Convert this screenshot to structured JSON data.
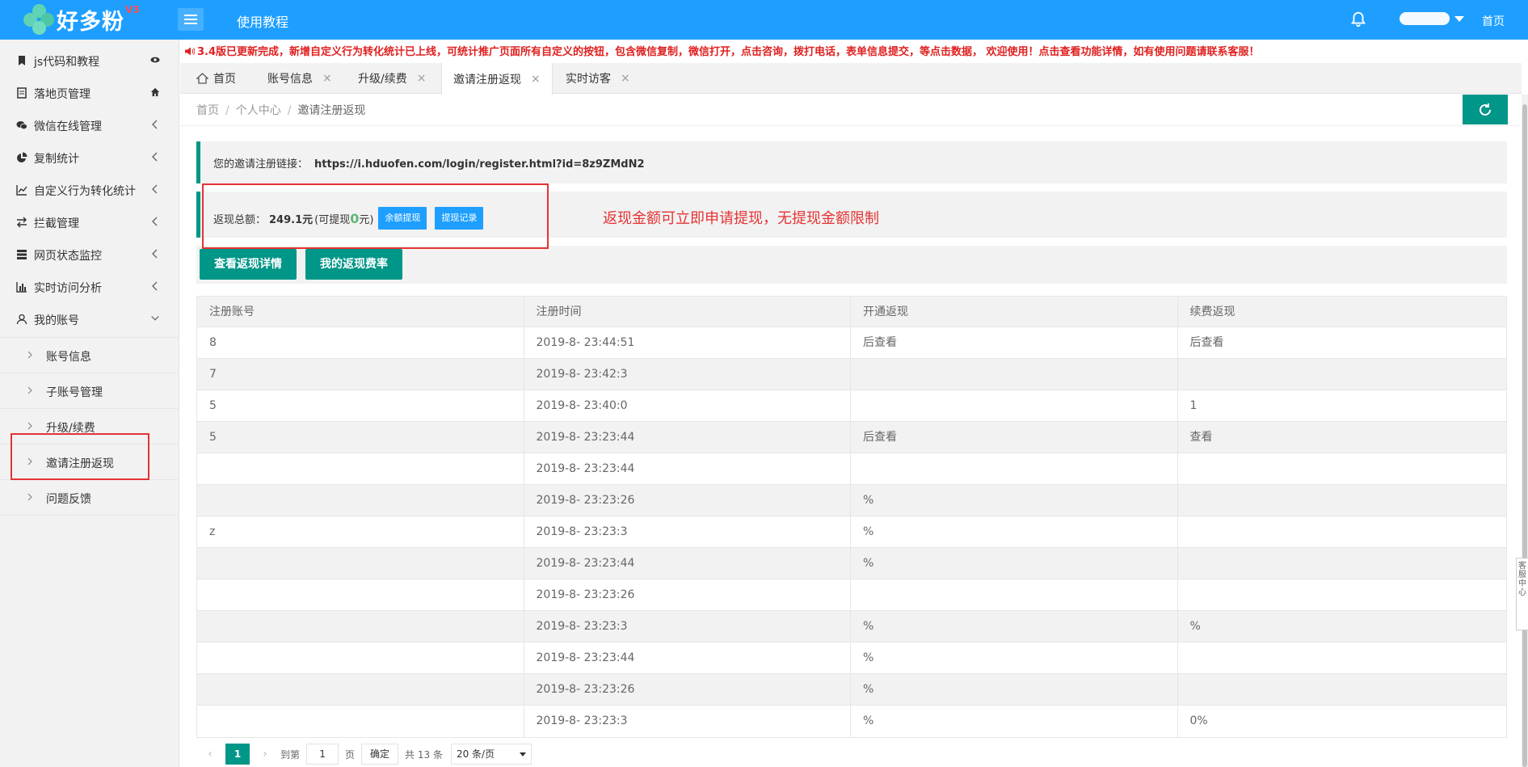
{
  "header": {
    "logo_text": "好多粉",
    "logo_version": "V3",
    "tutorial_label": "使用教程",
    "home_label": "首页",
    "bell_icon": "bell-icon",
    "brand_color": "#1e9fff"
  },
  "sidebar": {
    "items": [
      {
        "label": "js代码和教程",
        "icon": "bookmark-icon",
        "right_icon": "eye-icon"
      },
      {
        "label": "落地页管理",
        "icon": "document-icon",
        "right_icon": "home-icon"
      },
      {
        "label": "微信在线管理",
        "icon": "wechat-icon",
        "right_icon": "chevron-left-icon"
      },
      {
        "label": "复制统计",
        "icon": "pie-chart-icon",
        "right_icon": "chevron-left-icon"
      },
      {
        "label": "自定义行为转化统计",
        "icon": "line-chart-icon",
        "right_icon": "chevron-left-icon"
      },
      {
        "label": "拦截管理",
        "icon": "exchange-icon",
        "right_icon": "chevron-left-icon"
      },
      {
        "label": "网页状态监控",
        "icon": "server-icon",
        "right_icon": "chevron-left-icon"
      },
      {
        "label": "实时访问分析",
        "icon": "bar-chart-icon",
        "right_icon": "chevron-left-icon"
      },
      {
        "label": "我的账号",
        "icon": "user-icon",
        "right_icon": "chevron-down-icon"
      }
    ],
    "sub_items": [
      {
        "label": "账号信息"
      },
      {
        "label": "子账号管理"
      },
      {
        "label": "升级/续费"
      },
      {
        "label": "邀请注册返现"
      },
      {
        "label": "问题反馈"
      }
    ]
  },
  "notice": "3.4版已更新完成，新增自定义行为转化统计已上线，可统计推广页面所有自定义的按钮，包含微信复制，微信打开，点击咨询，拨打电话，表单信息提交，等点击数据， 欢迎使用！点击查看功能详情，如有使用问题请联系客服！",
  "tabs": [
    {
      "label": "首页",
      "icon": "home-outline-icon"
    },
    {
      "label": "账号信息",
      "close": "×"
    },
    {
      "label": "升级/续费",
      "close": "×"
    },
    {
      "label": "邀请注册返现",
      "close": "×"
    },
    {
      "label": "实时访客",
      "close": "×"
    }
  ],
  "breadcrumb": [
    "首页",
    "个人中心",
    "邀请注册返现"
  ],
  "breadcrumb_sep": "/",
  "invite": {
    "link_label": "您的邀请注册链接：",
    "link_url": "https://i.hduofen.com/login/register.html?id=8z9ZMdN2"
  },
  "cashback": {
    "total_label": "返现总额：",
    "total_value": "249.1元",
    "withdrawable_prefix": "(可提现",
    "withdrawable_value": "0",
    "withdrawable_suffix": "元)",
    "withdraw_button": "余额提现",
    "record_button": "提现记录",
    "promo_text": "返现金额可立即申请提现，无提现金额限制"
  },
  "actions": {
    "details_button": "查看返现详情",
    "rate_button": "我的返现费率"
  },
  "table": {
    "columns": [
      "注册账号",
      "注册时间",
      "开通返现",
      "续费返现"
    ],
    "rows": [
      [
        "8",
        "2019-8-  23:44:51",
        "  后查看",
        "  后查看"
      ],
      [
        "7",
        "2019-8-  23:42:3",
        "",
        ""
      ],
      [
        "5",
        "2019-8-  23:40:0",
        "",
        "1"
      ],
      [
        "5",
        "2019-8-  23:23:44",
        "  后查看",
        "  查看"
      ],
      [
        "",
        "2019-8-  23:23:44",
        "",
        ""
      ],
      [
        "",
        "2019-8-  23:23:26",
        "%",
        ""
      ],
      [
        "z",
        "2019-8-  23:23:3",
        "%",
        ""
      ],
      [
        "",
        "2019-8-  23:23:44",
        "%",
        ""
      ],
      [
        "",
        "2019-8-  23:23:26",
        "",
        ""
      ],
      [
        "",
        "2019-8-  23:23:3",
        "%",
        "%"
      ],
      [
        "",
        "2019-8-  23:23:44",
        "%",
        ""
      ],
      [
        "",
        "2019-8-  23:23:26",
        "%",
        ""
      ],
      [
        "",
        "2019-8-  23:23:3",
        "%",
        "0%"
      ]
    ]
  },
  "pagination": {
    "prev": "‹",
    "current_page": "1",
    "next": "›",
    "goto_label": "到第",
    "goto_value": "1",
    "page_unit": "页",
    "confirm": "确定",
    "total": "共 13 条",
    "per_page": "20 条/页"
  },
  "float_tab": "客服中心",
  "accent_color": "#009688",
  "alert_color": "#e53333"
}
